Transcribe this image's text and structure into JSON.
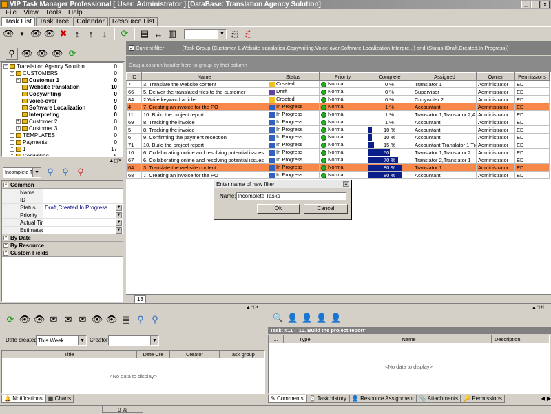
{
  "window": {
    "title": "VIP Task Manager Professional [ User: Administrator ] [DataBase: Translation Agency Solution]",
    "buttons": [
      "_",
      "□",
      "x"
    ]
  },
  "menu": [
    "File",
    "View",
    "Tools",
    "Help"
  ],
  "tabs": [
    "Task List",
    "Task Tree",
    "Calendar",
    "Resource List"
  ],
  "filter_bar": {
    "checkbox_label": "Current filter:",
    "text": "(Task Group  (Customer 1,Website translation,Copywriting,Voice-over,Software Localization,Interpre...) and (Status  (Draft,Created,In Progress))"
  },
  "group_hint": "Drag a column header here to group by that column",
  "tree": [
    {
      "label": "Translation Agency Solution",
      "count": "0",
      "level": 0,
      "bold": false
    },
    {
      "label": "CUSTOMERS",
      "count": "0",
      "level": 1,
      "bold": false
    },
    {
      "label": "Customer 1",
      "count": "0",
      "level": 2,
      "bold": true
    },
    {
      "label": "Website translation",
      "count": "10",
      "level": 3,
      "bold": true
    },
    {
      "label": "Copywriting",
      "count": "0",
      "level": 3,
      "bold": true
    },
    {
      "label": "Voice-over",
      "count": "9",
      "level": 3,
      "bold": true
    },
    {
      "label": "Software Localization",
      "count": "0",
      "level": 3,
      "bold": true
    },
    {
      "label": "Interpreting",
      "count": "0",
      "level": 3,
      "bold": true
    },
    {
      "label": "Customer 2",
      "count": "0",
      "level": 2,
      "bold": false
    },
    {
      "label": "Customer 3",
      "count": "0",
      "level": 2,
      "bold": false
    },
    {
      "label": "TEMPLATES",
      "count": "0",
      "level": 1,
      "bold": false
    },
    {
      "label": "Payments",
      "count": "0",
      "level": 1,
      "bold": false
    },
    {
      "label": "1",
      "count": "17",
      "level": 1,
      "bold": false
    },
    {
      "label": "Copwriting",
      "count": "5",
      "level": 1,
      "bold": false
    }
  ],
  "filter_combo": "Incomplete T...",
  "props": {
    "common": "Common",
    "rows": [
      {
        "label": "Name",
        "value": ""
      },
      {
        "label": "ID",
        "value": ""
      },
      {
        "label": "Status",
        "value": "Draft,Created,In Progress"
      },
      {
        "label": "Priority",
        "value": ""
      },
      {
        "label": "Actual Tim",
        "value": ""
      },
      {
        "label": "Estimated",
        "value": ""
      }
    ],
    "groups": [
      "By Date",
      "By Resource",
      "Custom Fields"
    ]
  },
  "grid": {
    "columns": [
      "ID",
      "Name",
      "Status",
      "Priority",
      "Complete",
      "Assigned",
      "Owner",
      "Permissions"
    ],
    "rows": [
      {
        "id": "7",
        "name": "3. Translate the website content",
        "status": "Created",
        "priority": "Normal",
        "complete": 0,
        "complete_text": "0 %",
        "assigned": "Translator 1",
        "owner": "Administrator",
        "perm": "ED",
        "hl": false,
        "status_color": "#f0c020"
      },
      {
        "id": "66",
        "name": "5. Deliver the translated files to the customer",
        "status": "Draft",
        "priority": "Normal",
        "complete": 0,
        "complete_text": "0 %",
        "assigned": "Supervisor",
        "owner": "Administrator",
        "perm": "ED",
        "hl": false,
        "status_color": "#6040a0"
      },
      {
        "id": "84",
        "name": "2.Write keyword article",
        "status": "Created",
        "priority": "Normal",
        "complete": 0,
        "complete_text": "0 %",
        "assigned": "Copywriter 2",
        "owner": "Administrator",
        "perm": "ED",
        "hl": false,
        "status_color": "#f0c020"
      },
      {
        "id": "4",
        "name": "7. Creating an invoice for the PO",
        "status": "In Progress",
        "priority": "Normal",
        "complete": 1,
        "complete_text": "1 %",
        "assigned": "Accountant",
        "owner": "Administrator",
        "perm": "ED",
        "hl": true,
        "status_color": "#3060c0"
      },
      {
        "id": "11",
        "name": "10. Build the project report",
        "status": "In Progress",
        "priority": "Normal",
        "complete": 1,
        "complete_text": "1 %",
        "assigned": "Translator 1,Translator 2,Acc",
        "owner": "Administrator",
        "perm": "ED",
        "hl": false,
        "status_color": "#3060c0"
      },
      {
        "id": "69",
        "name": "8. Tracking the invoice",
        "status": "In Progress",
        "priority": "Normal",
        "complete": 1,
        "complete_text": "1 %",
        "assigned": "Accountant",
        "owner": "Administrator",
        "perm": "ED",
        "hl": false,
        "status_color": "#3060c0"
      },
      {
        "id": "5",
        "name": "8. Tracking the invoice",
        "status": "In Progress",
        "priority": "Normal",
        "complete": 10,
        "complete_text": "10 %",
        "assigned": "Accountant",
        "owner": "Administrator",
        "perm": "ED",
        "hl": false,
        "status_color": "#3060c0"
      },
      {
        "id": "6",
        "name": "9. Confirming the payment reception",
        "status": "In Progress",
        "priority": "Normal",
        "complete": 10,
        "complete_text": "10 %",
        "assigned": "Accountant",
        "owner": "Administrator",
        "perm": "ED",
        "hl": false,
        "status_color": "#3060c0"
      },
      {
        "id": "71",
        "name": "10. Build the project report",
        "status": "In Progress",
        "priority": "Normal",
        "complete": 15,
        "complete_text": "15 %",
        "assigned": "Accountant,Translator 1,Trar",
        "owner": "Administrator",
        "perm": "ED",
        "hl": false,
        "status_color": "#3060c0"
      },
      {
        "id": "10",
        "name": "6. Collaborating online and resolving potential issues",
        "status": "In Progress",
        "priority": "Normal",
        "complete": 50,
        "complete_text": "50 %",
        "assigned": "Translator 1,Translator 2",
        "owner": "Administrator",
        "perm": "ED",
        "hl": false,
        "status_color": "#3060c0"
      },
      {
        "id": "67",
        "name": "6. Collaborating online and resolving potential issues",
        "status": "In Progress",
        "priority": "Normal",
        "complete": 70,
        "complete_text": "70 %",
        "assigned": "Translator 2,Translator 1",
        "owner": "Administrator",
        "perm": "ED",
        "hl": false,
        "status_color": "#3060c0"
      },
      {
        "id": "64",
        "name": "3. Translate the website content",
        "status": "In Progress",
        "priority": "Normal",
        "complete": 80,
        "complete_text": "80 %",
        "assigned": "Translator 1",
        "owner": "Administrator",
        "perm": "ED",
        "hl": true,
        "status_color": "#3060c0"
      },
      {
        "id": "68",
        "name": "7. Creating an invoice for the PO",
        "status": "In Progress",
        "priority": "Normal",
        "complete": 80,
        "complete_text": "80 %",
        "assigned": "Accountant",
        "owner": "Administrator",
        "perm": "ED",
        "hl": false,
        "status_color": "#3060c0"
      }
    ],
    "footer_count": "13"
  },
  "dialog": {
    "title": "Enter name of new filter",
    "name_label": "Name:",
    "name_value": "Incomplete Tasks",
    "ok": "Ok",
    "cancel": "Cancel"
  },
  "notifications": {
    "date_label": "Date created:",
    "date_value": "This Week",
    "creator_label": "Creator:",
    "columns": [
      "Title",
      "Date Cre",
      "Creator",
      "Task group"
    ],
    "empty": "<No data to display>",
    "tabs": [
      "Notifications",
      "Charts"
    ]
  },
  "details": {
    "task_title": "Task: #11 - '10. Build the project report'",
    "columns": [
      "...",
      "Type",
      "Name",
      "Description"
    ],
    "empty": "<No data to display>",
    "tabs": [
      "Comments",
      "Task history",
      "Resource Assignment",
      "Attachments",
      "Permissions"
    ]
  },
  "status": {
    "progress": "0 %"
  },
  "colors": {
    "highlight_row": "#f8884a",
    "progress_fill": "#0a1e8a",
    "priority_green": "#20b020"
  }
}
